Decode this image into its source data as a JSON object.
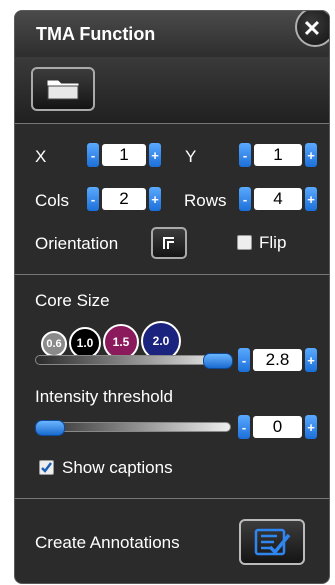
{
  "window": {
    "title": "TMA Function",
    "close_label": "✕"
  },
  "toolbar": {
    "open_icon": "folder-icon"
  },
  "position": {
    "x_label": "X",
    "x_value": "1",
    "y_label": "Y",
    "y_value": "1",
    "cols_label": "Cols",
    "cols_value": "2",
    "rows_label": "Rows",
    "rows_value": "4",
    "orientation_label": "Orientation",
    "flip_label": "Flip",
    "flip_checked": false
  },
  "core": {
    "label": "Core Size",
    "presets": [
      {
        "label": "0.6",
        "color": "#8a8a8a"
      },
      {
        "label": "1.0",
        "color": "#000000"
      },
      {
        "label": "1.5",
        "color": "#8a1a5c"
      },
      {
        "label": "2.0",
        "color": "#1a237e"
      }
    ],
    "slider_fraction": 1.0,
    "value": "2.8"
  },
  "intensity": {
    "label": "Intensity threshold",
    "slider_fraction": 0.0,
    "value": "0",
    "captions_label": "Show captions",
    "captions_checked": true
  },
  "annotations": {
    "label": "Create Annotations"
  },
  "stepper": {
    "minus": "-",
    "plus": "+"
  },
  "colors": {
    "panel": "#2b2b2b",
    "accent": "#2f86f0"
  }
}
